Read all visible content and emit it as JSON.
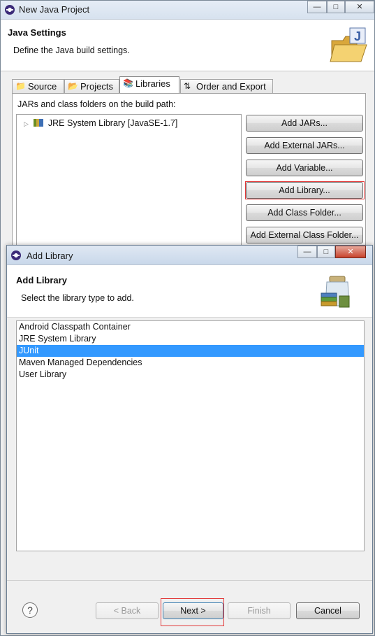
{
  "outer_window": {
    "title": "New Java Project",
    "header_title": "Java Settings",
    "header_desc": "Define the Java build settings.",
    "tabs": [
      {
        "label": "Source",
        "icon": "source-folder-icon"
      },
      {
        "label": "Projects",
        "icon": "folder-icon"
      },
      {
        "label": "Libraries",
        "icon": "library-icon",
        "active": true
      },
      {
        "label": "Order and Export",
        "icon": "order-export-icon"
      }
    ],
    "build_path_label": "JARs and class folders on the build path:",
    "tree_items": [
      "JRE System Library [JavaSE-1.7]"
    ],
    "buttons": [
      "Add JARs...",
      "Add External JARs...",
      "Add Variable...",
      "Add Library...",
      "Add Class Folder...",
      "Add External Class Folder..."
    ]
  },
  "dialog": {
    "title": "Add Library",
    "header_title": "Add Library",
    "header_desc": "Select the library type to add.",
    "library_types": [
      "Android Classpath Container",
      "JRE System Library",
      "JUnit",
      "Maven Managed Dependencies",
      "User Library"
    ],
    "selected_index": 2,
    "help": "?",
    "back_label": "< Back",
    "next_label": "Next >",
    "finish_label": "Finish",
    "cancel_label": "Cancel"
  },
  "colors": {
    "selection": "#3399ff",
    "highlight_box": "#e23a3a"
  }
}
